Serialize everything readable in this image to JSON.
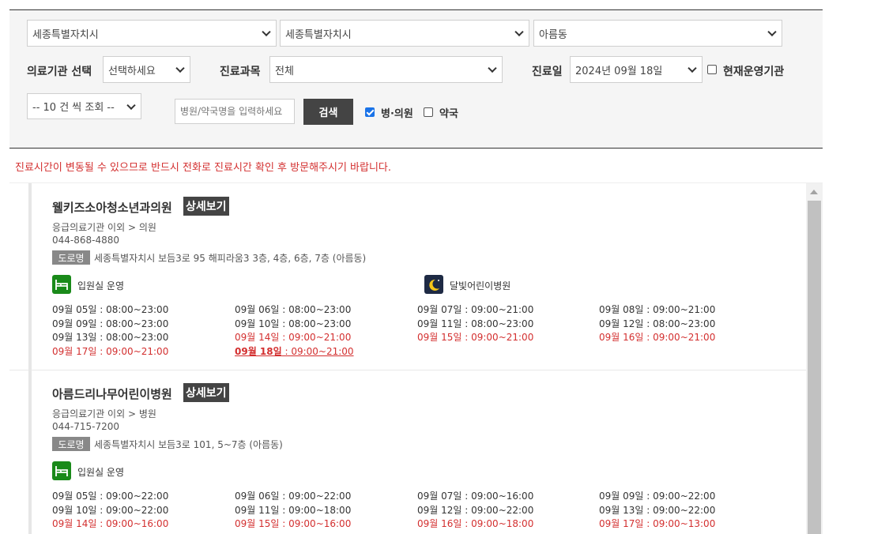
{
  "filters": {
    "sido": "세종특별자치시",
    "sigungu": "세종특별자치시",
    "dong": "아름동",
    "inst_label": "의료기관 선택",
    "inst_value": "선택하세요",
    "dept_label": "진료과목",
    "dept_value": "전체",
    "date_label": "진료일",
    "date_value": "2024년 09월 18일",
    "open_now_label": "현재운영기관",
    "open_now_checked": false,
    "page_size": "-- 10 건 씩 조회 --",
    "search_placeholder": "병원/약국명을 입력하세요",
    "search_button": "검색",
    "clinic_label": "병·의원",
    "clinic_checked": true,
    "pharmacy_label": "약국",
    "pharmacy_checked": false
  },
  "notice": "진료시간이 변동될 수 있으므로 반드시 전화로 진료시간 확인 후 방문해주시기 바랍니다.",
  "detail_label": "상세보기",
  "road_label": "도로명",
  "results": [
    {
      "name": "웰키즈소아청소년과의원",
      "category": "응급의료기관 이외 > 의원",
      "phone": "044-868-4880",
      "address": "세종특별자치시 보듬3로 95 해피라움3 3층, 4층, 6층, 7층 (아름동)",
      "features": [
        {
          "icon": "bed-icon",
          "label": "입원실 운영"
        },
        {
          "icon": "moon-icon",
          "label": "달빛어린이병원"
        }
      ],
      "hours": [
        {
          "date": "09월 05일",
          "time": "08:00~23:00",
          "style": "normal"
        },
        {
          "date": "09월 06일",
          "time": "08:00~23:00",
          "style": "normal"
        },
        {
          "date": "09월 07일",
          "time": "09:00~21:00",
          "style": "normal"
        },
        {
          "date": "09월 08일",
          "time": "09:00~21:00",
          "style": "normal"
        },
        {
          "date": "09월 09일",
          "time": "08:00~23:00",
          "style": "normal"
        },
        {
          "date": "09월 10일",
          "time": "08:00~23:00",
          "style": "normal"
        },
        {
          "date": "09월 11일",
          "time": "08:00~23:00",
          "style": "normal"
        },
        {
          "date": "09월 12일",
          "time": "08:00~23:00",
          "style": "normal"
        },
        {
          "date": "09월 13일",
          "time": "08:00~23:00",
          "style": "normal"
        },
        {
          "date": "09월 14일",
          "time": "09:00~21:00",
          "style": "red"
        },
        {
          "date": "09월 15일",
          "time": "09:00~21:00",
          "style": "red"
        },
        {
          "date": "09월 16일",
          "time": "09:00~21:00",
          "style": "red"
        },
        {
          "date": "09월 17일",
          "time": "09:00~21:00",
          "style": "red"
        },
        {
          "date": "09월 18일",
          "time": "09:00~21:00",
          "style": "today"
        }
      ]
    },
    {
      "name": "아름드리나무어린이병원",
      "category": "응급의료기관 이외 > 병원",
      "phone": "044-715-7200",
      "address": "세종특별자치시 보듬3로 101, 5~7층 (아름동)",
      "features": [
        {
          "icon": "bed-icon",
          "label": "입원실 운영"
        }
      ],
      "hours": [
        {
          "date": "09월 05일",
          "time": "09:00~22:00",
          "style": "normal"
        },
        {
          "date": "09월 06일",
          "time": "09:00~22:00",
          "style": "normal"
        },
        {
          "date": "09월 07일",
          "time": "09:00~16:00",
          "style": "normal"
        },
        {
          "date": "09월 09일",
          "time": "09:00~22:00",
          "style": "normal"
        },
        {
          "date": "09월 10일",
          "time": "09:00~22:00",
          "style": "normal"
        },
        {
          "date": "09월 11일",
          "time": "09:00~18:00",
          "style": "normal"
        },
        {
          "date": "09월 12일",
          "time": "09:00~22:00",
          "style": "normal"
        },
        {
          "date": "09월 13일",
          "time": "09:00~22:00",
          "style": "normal"
        },
        {
          "date": "09월 14일",
          "time": "09:00~16:00",
          "style": "red"
        },
        {
          "date": "09월 15일",
          "time": "09:00~16:00",
          "style": "red"
        },
        {
          "date": "09월 16일",
          "time": "09:00~18:00",
          "style": "red"
        },
        {
          "date": "09월 17일",
          "time": "09:00~13:00",
          "style": "red"
        }
      ]
    }
  ]
}
